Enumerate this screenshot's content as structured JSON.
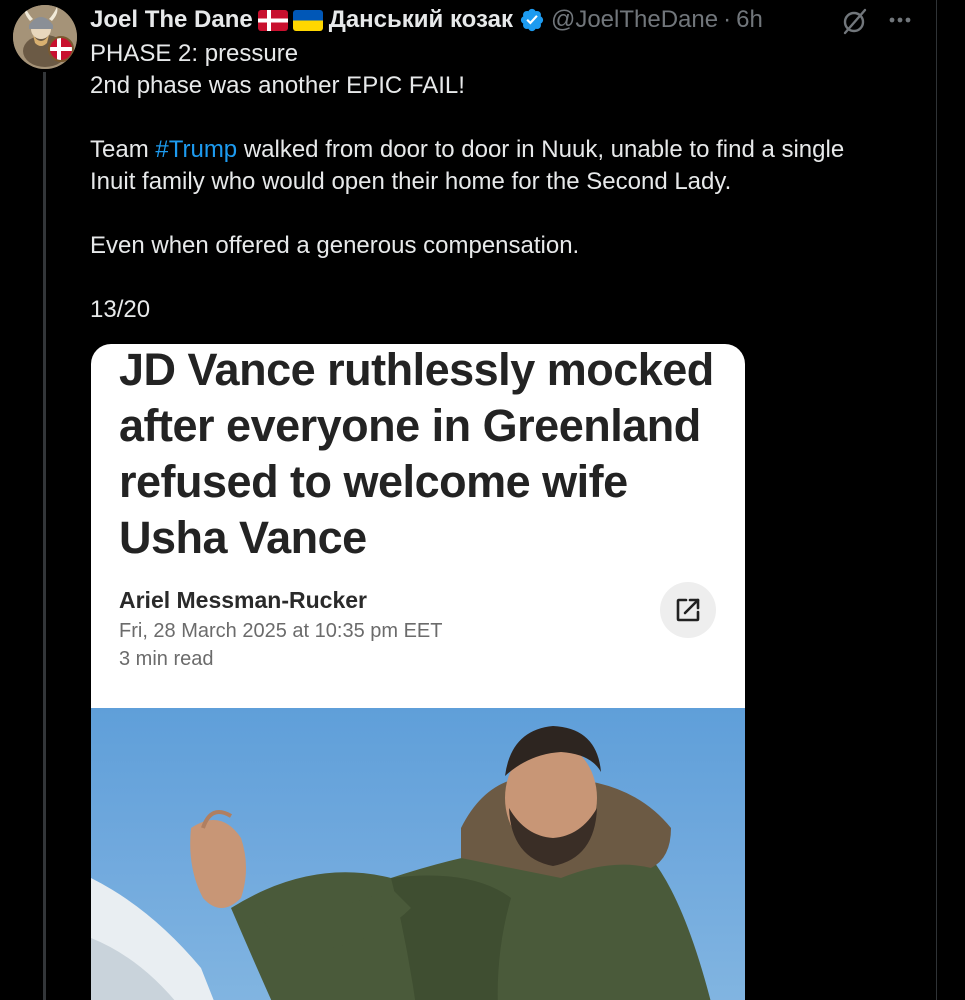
{
  "tweet": {
    "author": {
      "display_name": "Joel The Dane",
      "flags": [
        "denmark-flag",
        "ukraine-flag"
      ],
      "cyrillic_name": "Данський козак",
      "verified": true,
      "handle": "@JoelTheDane",
      "separator": "·",
      "time": "6h",
      "avatar_icon": "viking-avatar"
    },
    "lines": {
      "l1": "PHASE 2: pressure",
      "l2": "2nd phase was another EPIC FAIL!",
      "l3_prefix": "Team ",
      "l3_hashtag": "#Trump",
      "l3_suffix": " walked from door to door in Nuuk, unable to find a single",
      "l4": "Inuit family who would open their home for the Second Lady.",
      "l5": "Even when offered a generous compensation.",
      "l6": "13/20"
    },
    "actions": {
      "grok_icon": "grok-icon",
      "more_icon": "more-icon"
    }
  },
  "article_card": {
    "headline_lines": [
      "JD Vance ruthlessly mocked",
      "after everyone in Greenland",
      "refused to welcome wife",
      "Usha Vance"
    ],
    "author": "Ariel Messman-Rucker",
    "date": "Fri, 28 March 2025 at 10:35 pm EET",
    "read_time": "3 min read",
    "share_icon": "external-link-icon",
    "photo": "man-in-green-parka-pointing"
  },
  "colors": {
    "background": "#000000",
    "text": "#e7e9ea",
    "muted": "#71767b",
    "link": "#1d9bf0",
    "card_bg": "#ffffff",
    "headline": "#232323"
  }
}
